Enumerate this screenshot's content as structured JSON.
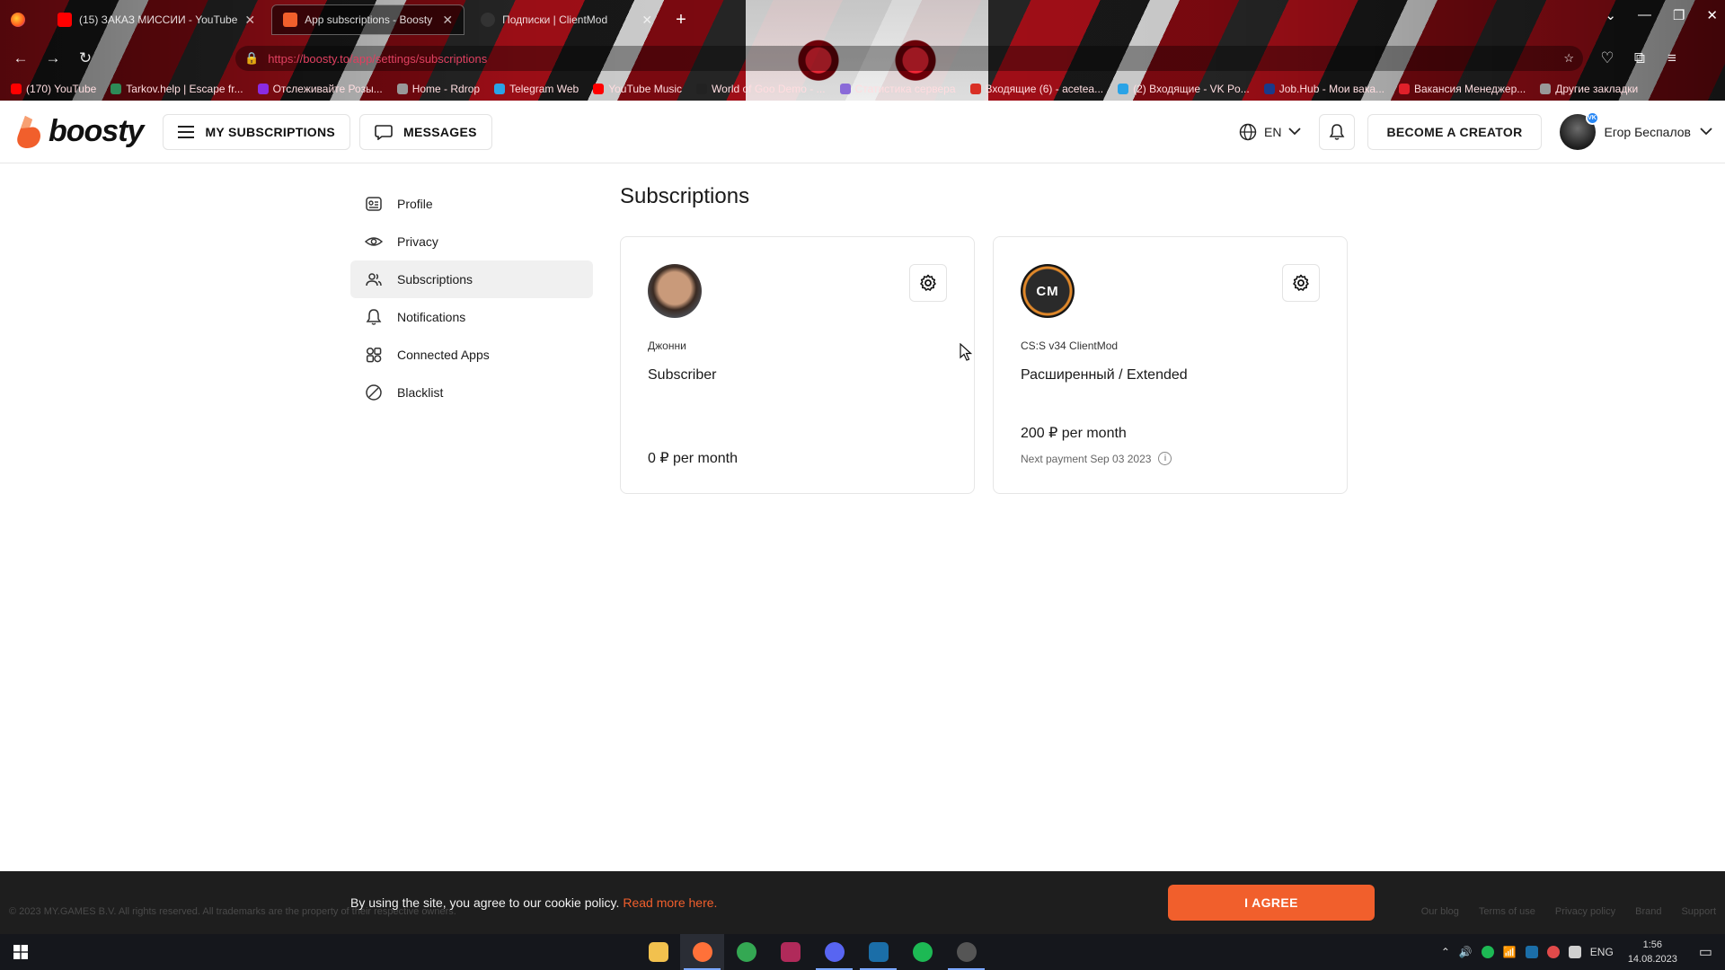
{
  "browser": {
    "tabs": [
      {
        "title": "(15) ЗАКАЗ МИССИИ - YouTube",
        "favicon_color": "#ff0000",
        "active": false
      },
      {
        "title": "App subscriptions - Boosty",
        "favicon_color": "#f15f2c",
        "active": true
      },
      {
        "title": "Подписки | ClientMod",
        "favicon_color": "#333333",
        "active": false
      }
    ],
    "new_tab_label": "+",
    "url": "https://boosty.to/app/settings/subscriptions",
    "bookmarks": [
      {
        "label": "(170) YouTube",
        "color": "#ff0000"
      },
      {
        "label": "Tarkov.help | Escape fr...",
        "color": "#2e8b57"
      },
      {
        "label": "Отслеживайте Розы...",
        "color": "#8a2be2"
      },
      {
        "label": "Home - Rdrop",
        "color": "#999999"
      },
      {
        "label": "Telegram Web",
        "color": "#2aa3e6"
      },
      {
        "label": "YouTube Music",
        "color": "#ff0000"
      },
      {
        "label": "World of Goo Demo - ...",
        "color": "#222222"
      },
      {
        "label": "Статистика сервера",
        "color": "#8a6ad8"
      },
      {
        "label": "Входящие (6) - acetea...",
        "color": "#d93025"
      },
      {
        "label": "(2) Входящие - VK Po...",
        "color": "#2aa3e6"
      },
      {
        "label": "Job.Hub - Мои вака...",
        "color": "#1a3a8a"
      },
      {
        "label": "Вакансия Менеджер...",
        "color": "#e0202a"
      },
      {
        "label": "Другие закладки",
        "color": "#999999"
      }
    ]
  },
  "header": {
    "logo_text": "boosty",
    "my_subscriptions_label": "MY SUBSCRIPTIONS",
    "messages_label": "MESSAGES",
    "language": "EN",
    "become_creator_label": "BECOME A CREATOR",
    "user_name": "Егор Беспалов",
    "vk_badge": "VK"
  },
  "sidebar": {
    "items": [
      {
        "label": "Profile",
        "icon": "profile-icon"
      },
      {
        "label": "Privacy",
        "icon": "eye-icon"
      },
      {
        "label": "Subscriptions",
        "icon": "users-icon",
        "active": true
      },
      {
        "label": "Notifications",
        "icon": "bell-icon"
      },
      {
        "label": "Connected Apps",
        "icon": "apps-icon"
      },
      {
        "label": "Blacklist",
        "icon": "block-icon"
      }
    ]
  },
  "main": {
    "title": "Subscriptions",
    "cards": [
      {
        "creator": "Джонни",
        "tier": "Subscriber",
        "price": "0 ₽ per month",
        "next_payment": ""
      },
      {
        "creator": "CS:S v34 ClientMod",
        "tier": "Расширенный / Extended",
        "price": "200 ₽ per month",
        "next_payment": "Next payment Sep 03 2023",
        "avatar_text": "CM"
      }
    ]
  },
  "cookie": {
    "text": "By using the site, you agree to our cookie policy.",
    "link": "Read more here.",
    "agree": "I AGREE"
  },
  "footer": {
    "copyright": "© 2023 MY.GAMES B.V. All rights reserved. All trademarks are the property of their respective owners.",
    "links": [
      "Our blog",
      "Terms of use",
      "Privacy policy",
      "Brand",
      "Support"
    ]
  },
  "taskbar": {
    "lang": "ENG",
    "time": "1:56",
    "date": "14.08.2023",
    "apps": [
      {
        "name": "file-explorer-icon",
        "color": "#f2c14e"
      },
      {
        "name": "firefox-icon",
        "color": "#ff7139"
      },
      {
        "name": "chrome-icon",
        "color": "#34a853"
      },
      {
        "name": "winrar-icon",
        "color": "#b02a5a"
      },
      {
        "name": "discord-icon",
        "color": "#5865f2"
      },
      {
        "name": "steam-icon",
        "color": "#1b6ea8"
      },
      {
        "name": "spotify-icon",
        "color": "#1db954"
      },
      {
        "name": "clientmod-icon",
        "color": "#555555"
      }
    ]
  }
}
